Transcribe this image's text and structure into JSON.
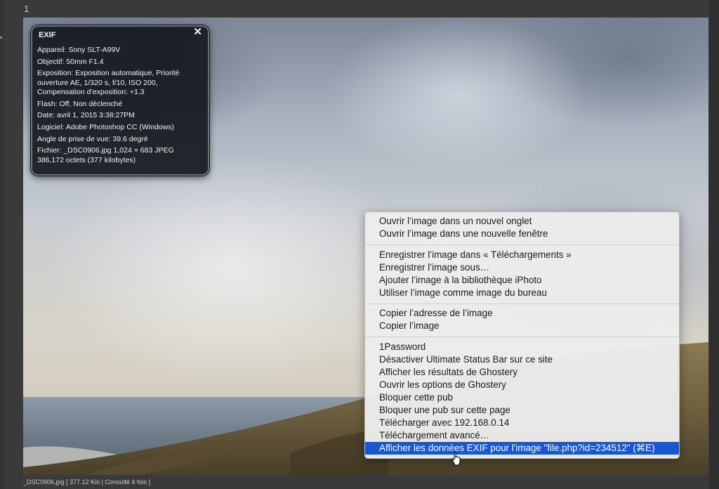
{
  "page": {
    "number": "1"
  },
  "exif": {
    "title": "EXIF",
    "close": "✕",
    "lines": [
      "Appareil: Sony SLT-A99V",
      "Objectif: 50mm F1.4",
      "Exposition: Exposition automatique, Priorité ouverture AE, 1/320 s, f/10, ISO 200, Compensation d’exposition: +1.3",
      "Flash: Off, Non déclenché",
      "Date: avril 1, 2015 3:38:27PM",
      "Logiciel: Adobe Photoshop CC (Windows)",
      "Angle de prise de vue: 39.6 degré",
      "Fichier: _DSC0906.jpg 1,024 × 683 JPEG\n386,172 octets (377 kilobytes)"
    ]
  },
  "context_menu": {
    "items": [
      "Ouvrir l’image dans un nouvel onglet",
      "Ouvrir l’image dans une nouvelle fenêtre",
      "Enregistrer l’image dans « Téléchargements »",
      "Enregistrer l’image sous…",
      "Ajouter l’image à la bibliothèque iPhoto",
      "Utiliser l’image comme image du bureau",
      "Copier l’adresse de l’image",
      "Copier l’image",
      "1Password",
      "Désactiver Ultimate Status Bar sur ce site",
      "Afficher les résultats de Ghostery",
      "Ouvrir les options de Ghostery",
      "Bloquer cette pub",
      "Bloquer une pub sur cette page",
      "Télécharger avec 192.168.0.14",
      "Téléchargement avancé…",
      "Afficher les données EXIF pour l'image \"file.php?id=234512\" (⌘E)"
    ],
    "highlighted_index": 16,
    "highlight_color": "#1757d6"
  },
  "status_bar": {
    "text": "_DSC0906.jpg [ 377.12 Kio | Consulté 4 fois ]"
  }
}
